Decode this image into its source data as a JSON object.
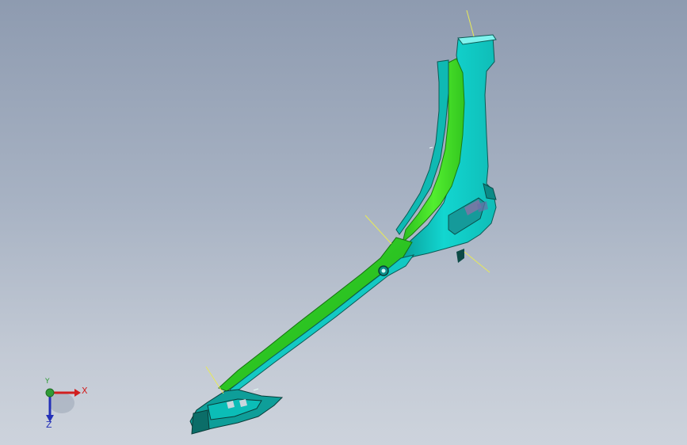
{
  "viewport": {
    "background_top": "#8e9bb0",
    "background_bottom": "#cdd3dc",
    "model": {
      "description_colors": {
        "surface_cyan": "#11d4cf",
        "surface_cyan_dark": "#0a9e9a",
        "surface_green": "#3fe32a",
        "surface_green_dark": "#1c9a14",
        "edge_dark": "#0c3f3a",
        "leader_line": "#e8ea57"
      }
    }
  },
  "triad": {
    "x_label": "X",
    "y_label": "Y",
    "z_label": "Z",
    "x_color": "#d11f1f",
    "y_color": "#2f9b36",
    "z_color": "#2330b8"
  }
}
